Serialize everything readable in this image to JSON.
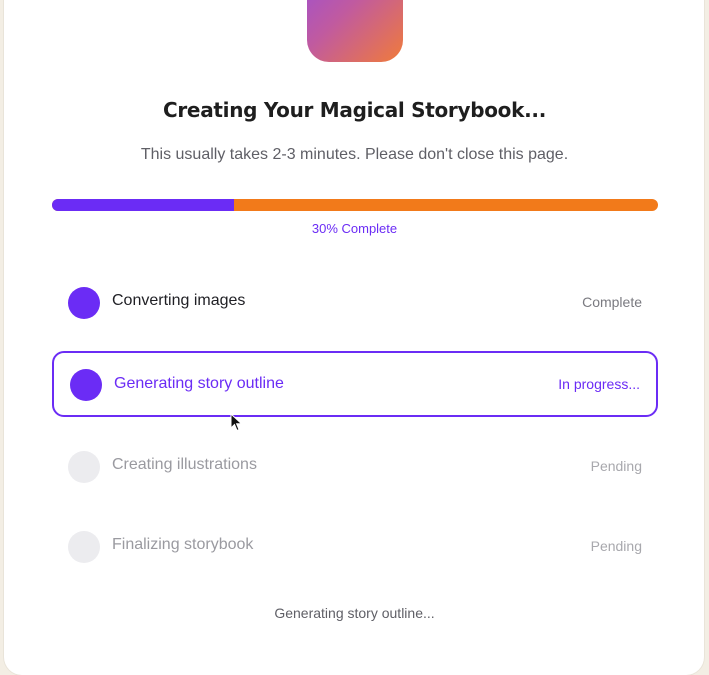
{
  "header": {
    "title": "Creating Your Magical Storybook...",
    "subtitle": "This usually takes 2-3 minutes. Please don't close this page."
  },
  "progress": {
    "percent": 30,
    "label": "30% Complete",
    "fill_color": "#6b2cf5",
    "track_color": "#f27a1a"
  },
  "steps": [
    {
      "label": "Converting images",
      "status": "Complete",
      "state": "done"
    },
    {
      "label": "Generating story outline",
      "status": "In progress...",
      "state": "active"
    },
    {
      "label": "Creating illustrations",
      "status": "Pending",
      "state": "pending"
    },
    {
      "label": "Finalizing storybook",
      "status": "Pending",
      "state": "pending"
    }
  ],
  "footer": {
    "current_status": "Generating story outline..."
  },
  "colors": {
    "accent": "#6b2cf5",
    "secondary": "#f27a1a"
  },
  "icons": {
    "logo": "app-logo-gradient",
    "cursor": "mouse-pointer-icon"
  }
}
